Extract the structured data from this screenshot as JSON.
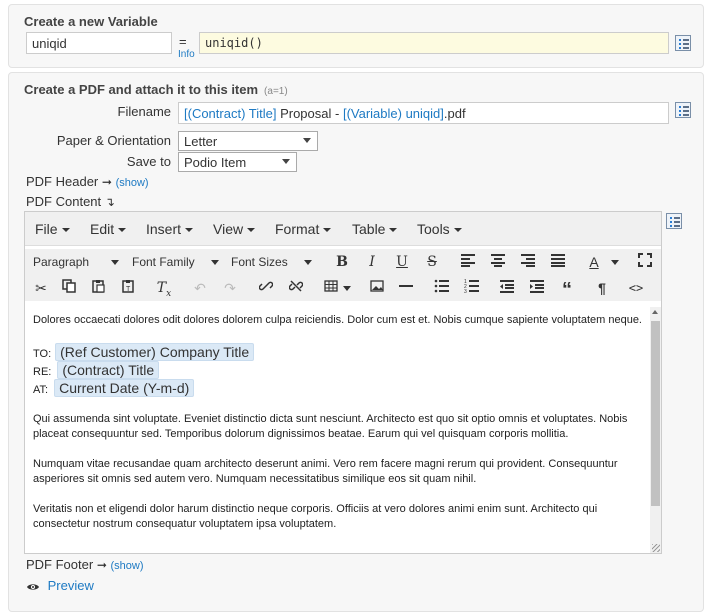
{
  "variable_panel": {
    "title": "Create a new Variable",
    "name_value": "uniqid",
    "equals": "=",
    "info_link": "Info",
    "expression_value": "uniqid()"
  },
  "pdf_panel": {
    "title": "Create a PDF and attach it to this item",
    "count_tag": "(a=1)",
    "filename_label": "Filename",
    "filename_parts": {
      "token1": "[(Contract) Title]",
      "text1": " Proposal - ",
      "token2": "[(Variable) uniqid]",
      "text2": ".pdf"
    },
    "paper_label": "Paper & Orientation",
    "paper_value": "Letter",
    "saveto_label": "Save to",
    "saveto_value": "Podio Item",
    "header_label": "PDF Header",
    "header_arrow": "➞",
    "show_link": "(show)",
    "content_label": "PDF Content",
    "content_arrow": "↴",
    "footer_label": "PDF Footer",
    "footer_arrow": "➞",
    "footer_show_link": "(show)",
    "preview_label": "Preview"
  },
  "editor": {
    "menus": [
      "File",
      "Edit",
      "Insert",
      "View",
      "Format",
      "Table",
      "Tools"
    ],
    "format_select": "Paragraph",
    "font_family_select": "Font Family",
    "font_size_select": "Font Sizes",
    "paragraphs": {
      "p1": "Dolores occaecati dolores odit dolores dolorem culpa reiciendis. Dolor cum est et. Nobis cumque sapiente voluptatem neque.",
      "to_label": "TO:",
      "to_value": "(Ref Customer) Company Title",
      "re_label": "RE:",
      "re_value": "(Contract) Title",
      "at_label": "AT:",
      "at_value": "Current Date (Y-m-d)",
      "p2": "Qui assumenda sint voluptate. Eveniet distinctio dicta sunt nesciunt. Architecto est quo sit optio omnis et voluptates. Nobis placeat consequuntur sed. Temporibus dolorum dignissimos beatae. Earum qui vel quisquam corporis mollitia.",
      "p3": "Numquam vitae recusandae quam architecto deserunt animi. Vero rem facere magni rerum qui provident. Consequuntur asperiores sit omnis sed autem vero. Numquam necessitatibus similique eos sit quam nihil.",
      "p4": "Veritatis non et eligendi dolor harum distinctio neque corporis. Officiis at vero dolores animi enim sunt. Architecto qui consectetur nostrum consequatur voluptatem ipsa voluptatem."
    }
  }
}
